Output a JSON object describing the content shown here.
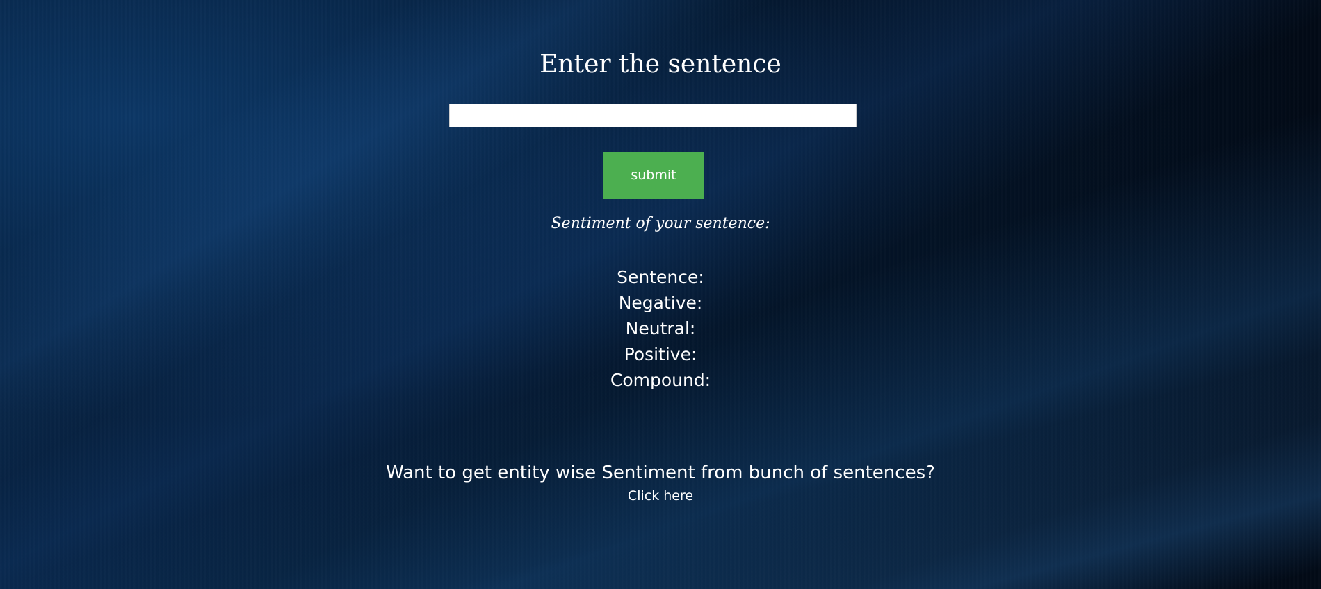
{
  "form": {
    "title": "Enter the sentence",
    "input_value": "",
    "input_placeholder": "",
    "submit_label": "submit"
  },
  "result": {
    "heading": "Sentiment of your sentence:",
    "rows": [
      {
        "label": "Sentence:",
        "value": ""
      },
      {
        "label": "Negative:",
        "value": ""
      },
      {
        "label": "Neutral:",
        "value": ""
      },
      {
        "label": "Positive:",
        "value": ""
      },
      {
        "label": "Compound:",
        "value": ""
      }
    ]
  },
  "footer": {
    "question": "Want to get entity wise Sentiment from bunch of sentences?",
    "link_text": "Click here"
  },
  "colors": {
    "background": "#04152a",
    "button": "#4caf50",
    "text": "#ffffff"
  }
}
